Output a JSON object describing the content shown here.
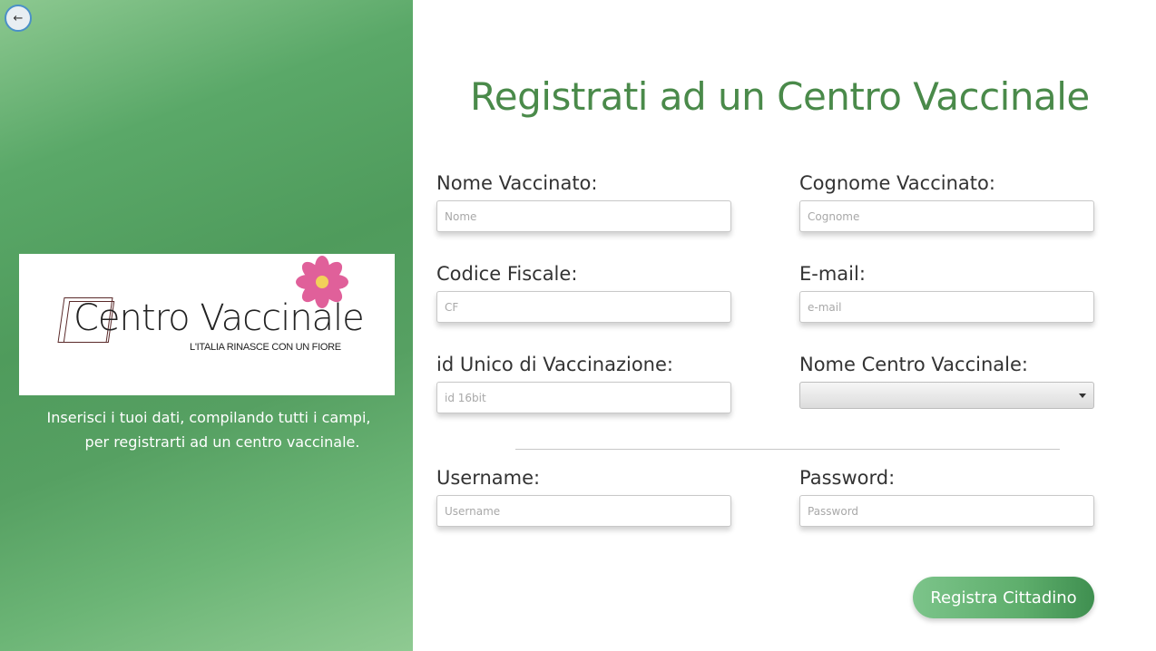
{
  "nav": {
    "back_label": "←"
  },
  "logo": {
    "title": "Centro Vaccinale",
    "tagline": "L'ITALIA RINASCE CON UN FIORE"
  },
  "sidebar": {
    "instructions_line1": "Inserisci i tuoi dati, compilando tutti i campi,",
    "instructions_line2": "per registrarti ad un centro vaccinale."
  },
  "form": {
    "title": "Registrati ad un Centro Vaccinale",
    "nome": {
      "label": "Nome Vaccinato:",
      "placeholder": "Nome",
      "value": ""
    },
    "cognome": {
      "label": "Cognome Vaccinato:",
      "placeholder": "Cognome",
      "value": ""
    },
    "codice_fiscale": {
      "label": "Codice Fiscale:",
      "placeholder": "CF",
      "value": ""
    },
    "email": {
      "label": "E-mail:",
      "placeholder": "e-mail",
      "value": ""
    },
    "id_unico": {
      "label": "id Unico di Vaccinazione:",
      "placeholder": "id 16bit",
      "value": ""
    },
    "centro": {
      "label": "Nome Centro Vaccinale:",
      "selected": ""
    },
    "username": {
      "label": "Username:",
      "placeholder": "Username",
      "value": ""
    },
    "password": {
      "label": "Password:",
      "placeholder": "Password",
      "value": ""
    },
    "submit_label": "Registra Cittadino"
  },
  "colors": {
    "accent_green": "#4a8a4a",
    "sidebar_green": "#5aa868",
    "flower_pink": "#e0609a",
    "flower_center": "#f2d15a"
  },
  "icons": {
    "back": "arrow-left-icon",
    "dropdown": "chevron-down-icon",
    "logo_flower": "flower-icon"
  }
}
